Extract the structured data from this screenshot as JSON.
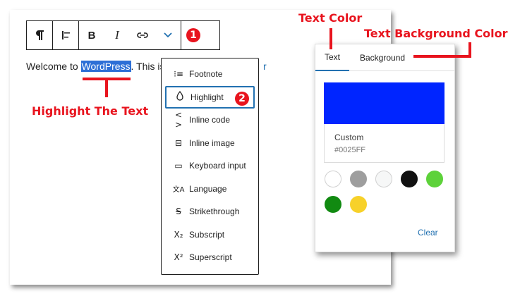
{
  "toolbar": {
    "paragraph_icon": "pilcrow-icon",
    "align_icon": "align-left-icon",
    "bold_label": "B",
    "italic_label": "I",
    "link_icon": "link-icon",
    "more_icon": "chevron-down-icon",
    "options_icon": "vertical-ellipsis-icon"
  },
  "paragraph": {
    "before": "Welcome to ",
    "highlighted": "WordPress",
    "after": ". This is",
    "tail": "r"
  },
  "dropdown": {
    "items": [
      {
        "label": "Footnote",
        "icon": "footnote-icon",
        "glyph": "⁝≡"
      },
      {
        "label": "Highlight",
        "icon": "drop-icon",
        "glyph": "💧",
        "selected": true
      },
      {
        "label": "Inline code",
        "icon": "code-icon",
        "glyph": "‹›"
      },
      {
        "label": "Inline image",
        "icon": "image-icon",
        "glyph": "⊟"
      },
      {
        "label": "Keyboard input",
        "icon": "keyboard-icon",
        "glyph": "▭"
      },
      {
        "label": "Language",
        "icon": "language-icon",
        "glyph": "文A"
      },
      {
        "label": "Strikethrough",
        "icon": "strikethrough-icon",
        "glyph": "S̶"
      },
      {
        "label": "Subscript",
        "icon": "subscript-icon",
        "glyph": "X₂"
      },
      {
        "label": "Superscript",
        "icon": "superscript-icon",
        "glyph": "X²"
      }
    ]
  },
  "popover": {
    "tabs": [
      "Text",
      "Background"
    ],
    "active_tab": "Text",
    "custom_label": "Custom",
    "custom_hex": "#0025FF",
    "swatch_color": "#0025FF",
    "palette": [
      "#ffffff",
      "#9e9e9e",
      "#f6f7f7",
      "#111111",
      "#5dd23a",
      "#118a11",
      "#f7d12a"
    ],
    "clear_label": "Clear"
  },
  "annotations": {
    "step1": "1",
    "step2": "2",
    "highlight_text": "Highlight The Text",
    "text_color": "Text Color",
    "text_bg_color": "Text Background Color",
    "accent": "#e8141e"
  }
}
